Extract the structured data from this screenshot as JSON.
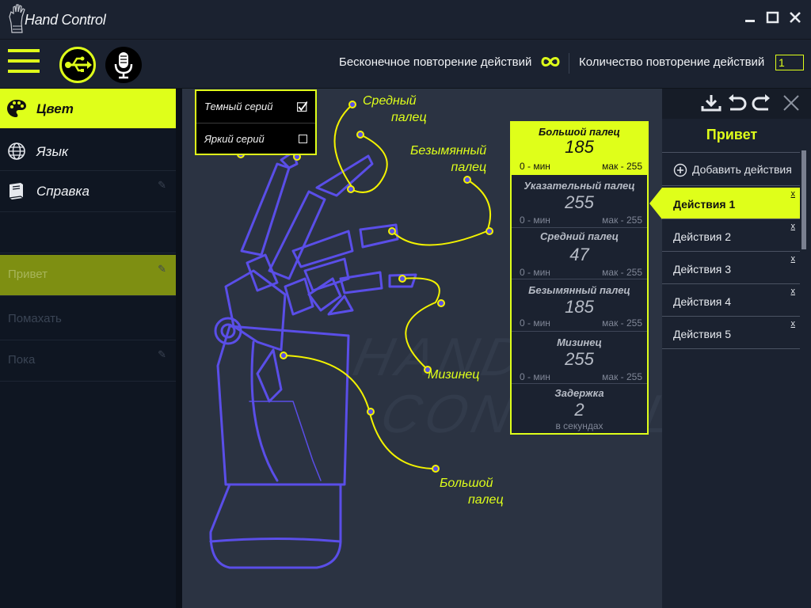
{
  "app": {
    "title": "Hand Control"
  },
  "window_controls": [
    "minimize-icon",
    "maximize-icon",
    "close-icon"
  ],
  "toolbar": {
    "infinite_repeat_label": "Бесконечное повторение действий",
    "repeat_count_label": "Количество повторение действий",
    "repeat_count_value": "1"
  },
  "sidebar": {
    "items": [
      {
        "label": "Цвет",
        "icon": "palette-icon",
        "active": true
      },
      {
        "label": "Язык",
        "icon": "globe-icon",
        "active": false
      },
      {
        "label": "Справка",
        "icon": "book-icon",
        "active": false
      }
    ],
    "background_rows": [
      {
        "label": "",
        "highlighted": false
      },
      {
        "label": "",
        "highlighted": false
      },
      {
        "label": "",
        "highlighted": false
      },
      {
        "label": "",
        "highlighted": false
      },
      {
        "label": "Привет",
        "highlighted": true
      },
      {
        "label": "Помахать",
        "highlighted": false
      },
      {
        "label": "Пока",
        "highlighted": false
      }
    ]
  },
  "theme_popup": {
    "options": [
      {
        "label": "Темный серий",
        "checked": true
      },
      {
        "label": "Яркий серий",
        "checked": false
      }
    ]
  },
  "finger_labels": {
    "middle": [
      "Средный",
      "палец"
    ],
    "ring": [
      "Безымянный",
      "палец"
    ],
    "pinky": "Мизинец",
    "thumb": [
      "Большой",
      "палец"
    ]
  },
  "watermark": [
    "HAND",
    "CONTROL"
  ],
  "values_panel": [
    {
      "name": "Большой палец",
      "value": "185",
      "min": "0 - мин",
      "max": "мак - 255",
      "highlighted": true
    },
    {
      "name": "Указательный палец",
      "value": "255",
      "min": "0 - мин",
      "max": "мак - 255",
      "highlighted": false
    },
    {
      "name": "Средний палец",
      "value": "47",
      "min": "0 - мин",
      "max": "мак - 255",
      "highlighted": false
    },
    {
      "name": "Безымянный палец",
      "value": "185",
      "min": "0 - мин",
      "max": "мак - 255",
      "highlighted": false
    },
    {
      "name": "Мизинец",
      "value": "255",
      "min": "0 - мин",
      "max": "мак - 255",
      "highlighted": false
    }
  ],
  "delay": {
    "name": "Задержка",
    "value": "2",
    "unit": "в секундах"
  },
  "canvas_tools": [
    "download-icon",
    "undo-icon",
    "redo-icon",
    "clear-icon"
  ],
  "actions_panel": {
    "title": "Привет",
    "add_label": "Добавить действия",
    "items": [
      {
        "label": "Действия 1",
        "active": true
      },
      {
        "label": "Действия 2",
        "active": false
      },
      {
        "label": "Действия 3",
        "active": false
      },
      {
        "label": "Действия 4",
        "active": false
      },
      {
        "label": "Действия 5",
        "active": false
      }
    ],
    "remove_glyph": "x"
  },
  "colors": {
    "accent": "#dfff1a",
    "hand_outline": "#5a4ee8",
    "background": "#161c27",
    "canvas": "#2b3342"
  }
}
